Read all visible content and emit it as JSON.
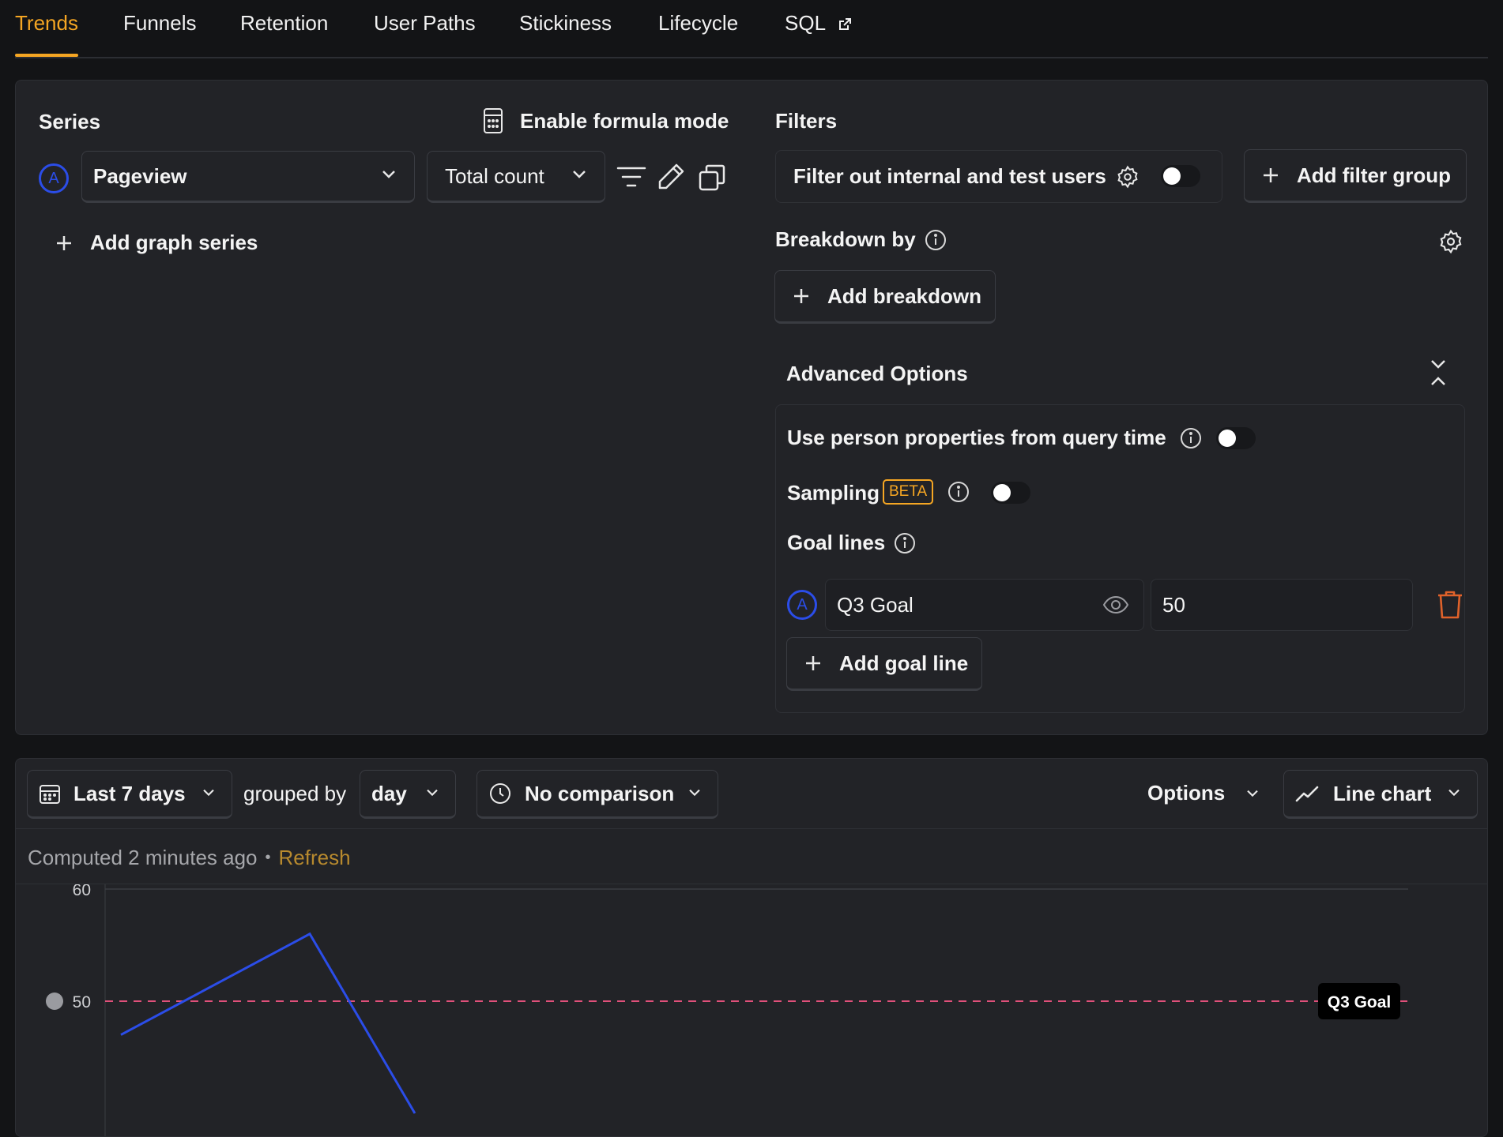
{
  "tabs": [
    {
      "label": "Trends",
      "active": true
    },
    {
      "label": "Funnels"
    },
    {
      "label": "Retention"
    },
    {
      "label": "User Paths"
    },
    {
      "label": "Stickiness"
    },
    {
      "label": "Lifecycle"
    },
    {
      "label": "SQL",
      "icon": "external-link-icon"
    }
  ],
  "series": {
    "heading": "Series",
    "formula_mode_label": "Enable formula mode",
    "items": [
      {
        "badge": "A",
        "event": "Pageview",
        "math": "Total count"
      }
    ],
    "add_series_label": "Add graph series"
  },
  "filters": {
    "heading": "Filters",
    "test_users_label": "Filter out internal and test users",
    "test_users_enabled": false,
    "add_filter_group_label": "Add filter group"
  },
  "breakdown": {
    "heading": "Breakdown by",
    "add_breakdown_label": "Add breakdown"
  },
  "advanced": {
    "heading": "Advanced Options",
    "person_props_label": "Use person properties from query time",
    "person_props_enabled": false,
    "sampling_label": "Sampling",
    "sampling_badge": "BETA",
    "sampling_enabled": false,
    "goal_lines_label": "Goal lines",
    "goal_lines": [
      {
        "badge": "A",
        "label": "Q3 Goal",
        "value": "50"
      }
    ],
    "add_goal_line_label": "Add goal line"
  },
  "toolbar": {
    "date_range": "Last 7 days",
    "grouped_by_label": "grouped by",
    "interval": "day",
    "comparison": "No comparison",
    "options_label": "Options",
    "chart_type": "Line chart"
  },
  "status": {
    "computed": "Computed 2 minutes ago",
    "separator": "•",
    "refresh_label": "Refresh"
  },
  "colors": {
    "accent": "#f5a623",
    "series_a": "#2b4de8",
    "goal_line": "#e0507a",
    "danger": "#e0622a"
  },
  "chart_data": {
    "type": "line",
    "y_ticks": [
      60,
      50
    ],
    "ylim": [
      40,
      60
    ],
    "series": [
      {
        "values": [
          47,
          56,
          40
        ]
      }
    ],
    "goal_lines": [
      {
        "label": "Q3 Goal",
        "value": 50
      }
    ]
  }
}
